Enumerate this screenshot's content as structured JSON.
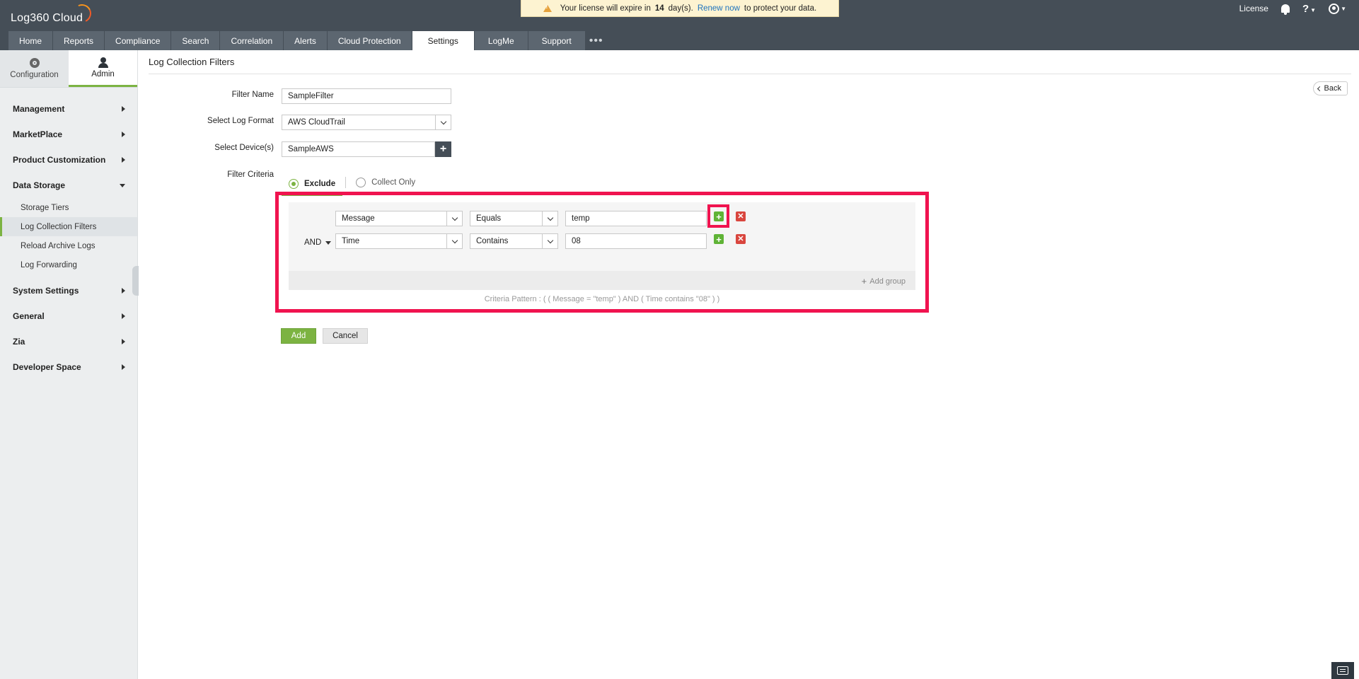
{
  "header": {
    "logo_text": "Log360 Cloud",
    "license_notice": {
      "prefix": "Your license will expire in",
      "days": "14",
      "middle": "day(s).",
      "link": "Renew now",
      "suffix": "to protect your data."
    },
    "license_label": "License",
    "help_label": "?"
  },
  "tabs": [
    {
      "label": "Home"
    },
    {
      "label": "Reports"
    },
    {
      "label": "Compliance"
    },
    {
      "label": "Search"
    },
    {
      "label": "Correlation"
    },
    {
      "label": "Alerts"
    },
    {
      "label": "Cloud Protection"
    },
    {
      "label": "Settings",
      "active": true
    },
    {
      "label": "LogMe"
    },
    {
      "label": "Support"
    }
  ],
  "sidebar": {
    "switch": {
      "configuration": "Configuration",
      "admin": "Admin"
    },
    "sections": {
      "management": "Management",
      "marketplace": "MarketPlace",
      "product_customization": "Product Customization",
      "data_storage": "Data Storage",
      "system_settings": "System Settings",
      "general": "General",
      "zia": "Zia",
      "developer_space": "Developer Space"
    },
    "data_storage_items": {
      "storage_tiers": "Storage Tiers",
      "log_collection_filters": "Log Collection Filters",
      "reload_archive_logs": "Reload Archive Logs",
      "log_forwarding": "Log Forwarding"
    }
  },
  "page": {
    "title": "Log Collection Filters",
    "back_label": "Back",
    "form": {
      "filter_name_label": "Filter Name",
      "filter_name_value": "SampleFilter",
      "log_format_label": "Select Log Format",
      "log_format_value": "AWS CloudTrail",
      "devices_label": "Select Device(s)",
      "devices_value": "SampleAWS",
      "criteria_label": "Filter Criteria",
      "criteria_mode": {
        "exclude": "Exclude",
        "collect_only": "Collect Only",
        "selected": "exclude"
      }
    },
    "criteria": {
      "operator": "AND",
      "rows": [
        {
          "field": "Message",
          "condition": "Equals",
          "value": "temp"
        },
        {
          "field": "Time",
          "condition": "Contains",
          "value": "08"
        }
      ],
      "add_group_label": "Add group",
      "pattern": "Criteria Pattern : ( ( Message = \"temp\" ) AND ( Time contains \"08\" ) )"
    },
    "actions": {
      "add": "Add",
      "cancel": "Cancel"
    }
  },
  "colors": {
    "header_bg": "#454e57",
    "accent_green": "#7cb342",
    "highlight_red": "#f0134f",
    "delete_red": "#d9463e",
    "link_blue": "#1e73be"
  }
}
